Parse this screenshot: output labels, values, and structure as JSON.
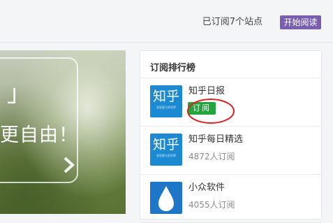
{
  "header": {
    "subscription_status": "已订阅7个站点",
    "start_reading_label": "开始阅读"
  },
  "hero": {
    "quote_mark": "」",
    "text": "更自由！"
  },
  "ranking": {
    "title": "订阅排行榜",
    "items": [
      {
        "name": "知乎日报",
        "icon": "zhihu-daily-icon",
        "icon_text": "知乎",
        "icon_subtext": "发现更大的世界",
        "action_label": "订阅"
      },
      {
        "name": "知乎每日精选",
        "icon": "zhihu-icon",
        "icon_text": "知乎",
        "icon_subtext": "发现更大的世界",
        "meta": "4872人订阅"
      },
      {
        "name": "小众软件",
        "icon": "water-drop-icon",
        "meta": "4055人订阅"
      }
    ]
  },
  "colors": {
    "start_button": "#7a5fb0",
    "subscribe_button": "#22a53c",
    "zhihu_blue": "#1c8ad3",
    "annotation_circle": "#e02020"
  }
}
